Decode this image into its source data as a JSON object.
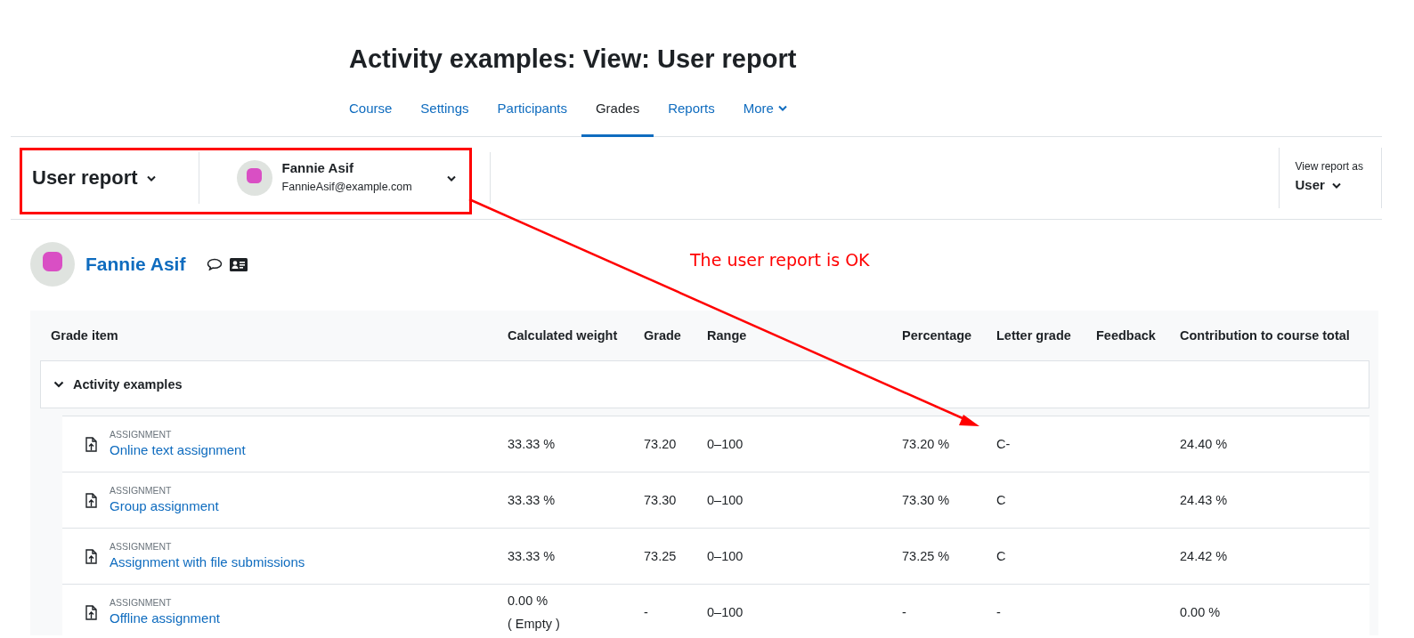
{
  "page_title": "Activity examples: View: User report",
  "tabs": [
    {
      "label": "Course",
      "selected": false,
      "kind": "link"
    },
    {
      "label": "Settings",
      "selected": false,
      "kind": "link"
    },
    {
      "label": "Participants",
      "selected": false,
      "kind": "link"
    },
    {
      "label": "Grades",
      "selected": true,
      "kind": "link"
    },
    {
      "label": "Reports",
      "selected": false,
      "kind": "link"
    },
    {
      "label": "More",
      "selected": false,
      "kind": "dropdown"
    }
  ],
  "report_selector": {
    "label": "User report"
  },
  "user_selector": {
    "name": "Fannie Asif",
    "email": "FannieAsif@example.com"
  },
  "view_as": {
    "label": "View report as",
    "value": "User"
  },
  "user": {
    "name": "Fannie Asif"
  },
  "table": {
    "columns": [
      "Grade item",
      "Calculated weight",
      "Grade",
      "Range",
      "Percentage",
      "Letter grade",
      "Feedback",
      "Contribution to course total"
    ],
    "category": {
      "name": "Activity examples",
      "expanded": true
    },
    "rows": [
      {
        "type": "ASSIGNMENT",
        "name": "Online text assignment",
        "weight": "33.33 %",
        "grade": "73.20",
        "range": "0–100",
        "percentage": "73.20 %",
        "letter": "C-",
        "contribution": "24.40 %"
      },
      {
        "type": "ASSIGNMENT",
        "name": "Group assignment",
        "weight": "33.33 %",
        "grade": "73.30",
        "range": "0–100",
        "percentage": "73.30 %",
        "letter": "C",
        "contribution": "24.43 %"
      },
      {
        "type": "ASSIGNMENT",
        "name": "Assignment with file submissions",
        "weight": "33.33 %",
        "grade": "73.25",
        "range": "0–100",
        "percentage": "73.25 %",
        "letter": "C",
        "contribution": "24.42 %"
      },
      {
        "type": "ASSIGNMENT",
        "name": "Offline assignment",
        "weight": "0.00 %",
        "weight_note": "( Empty )",
        "grade": "-",
        "range": "0–100",
        "percentage": "-",
        "letter": "-",
        "contribution": "0.00 %"
      }
    ]
  },
  "annotation": {
    "text": "The user report is OK"
  }
}
